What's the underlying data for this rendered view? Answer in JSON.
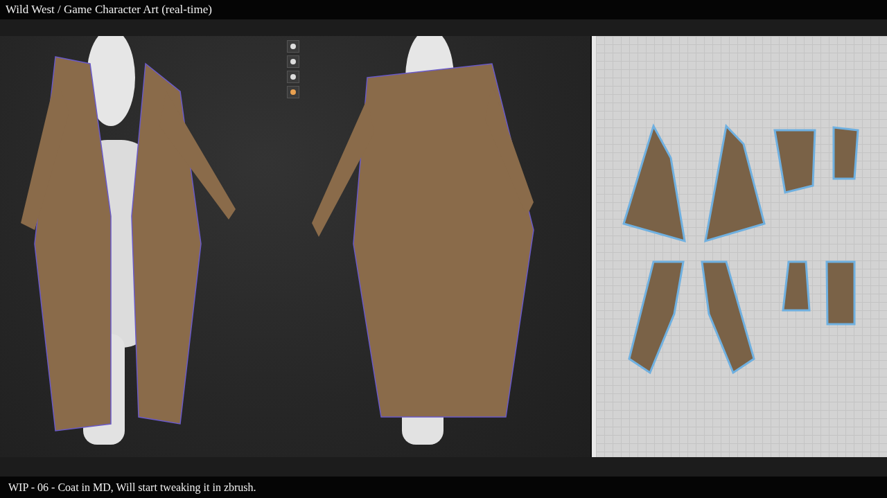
{
  "header": {
    "title": "Wild West / Game Character Art (real-time)"
  },
  "caption": {
    "text": "WIP - 06 - Coat in MD, Will start tweaking it in zbrush."
  }
}
